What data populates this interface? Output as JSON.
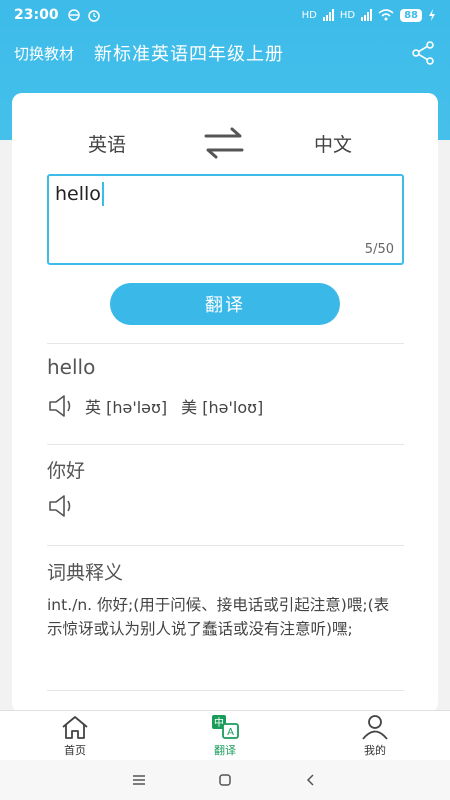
{
  "status": {
    "time": "23:00",
    "battery": "88",
    "signal1": "HD",
    "signal2": "HD"
  },
  "header": {
    "switch_label": "切换教材",
    "title": "新标准英语四年级上册"
  },
  "card": {
    "source_lang": "英语",
    "target_lang": "中文",
    "input_value": "hello",
    "char_count": "5/50",
    "translate_label": "翻译"
  },
  "result": {
    "word": "hello",
    "uk_label": "英",
    "uk_phonetic": "[hə'ləʊ]",
    "us_label": "美",
    "us_phonetic": "[hə'loʊ]",
    "translation": "你好",
    "dict_title": "词典释义",
    "dict_text": "int./n. 你好;(用于问候、接电话或引起注意)喂;(表示惊讶或认为别人说了蠢话或没有注意听)嘿;"
  },
  "nav": {
    "items": [
      {
        "label": "首页",
        "icon": "home-icon"
      },
      {
        "label": "翻译",
        "icon": "translate-icon",
        "active": true
      },
      {
        "label": "我的",
        "icon": "profile-icon"
      }
    ]
  },
  "colors": {
    "primary": "#3dbbe9",
    "active_nav": "#1a9c5b"
  }
}
